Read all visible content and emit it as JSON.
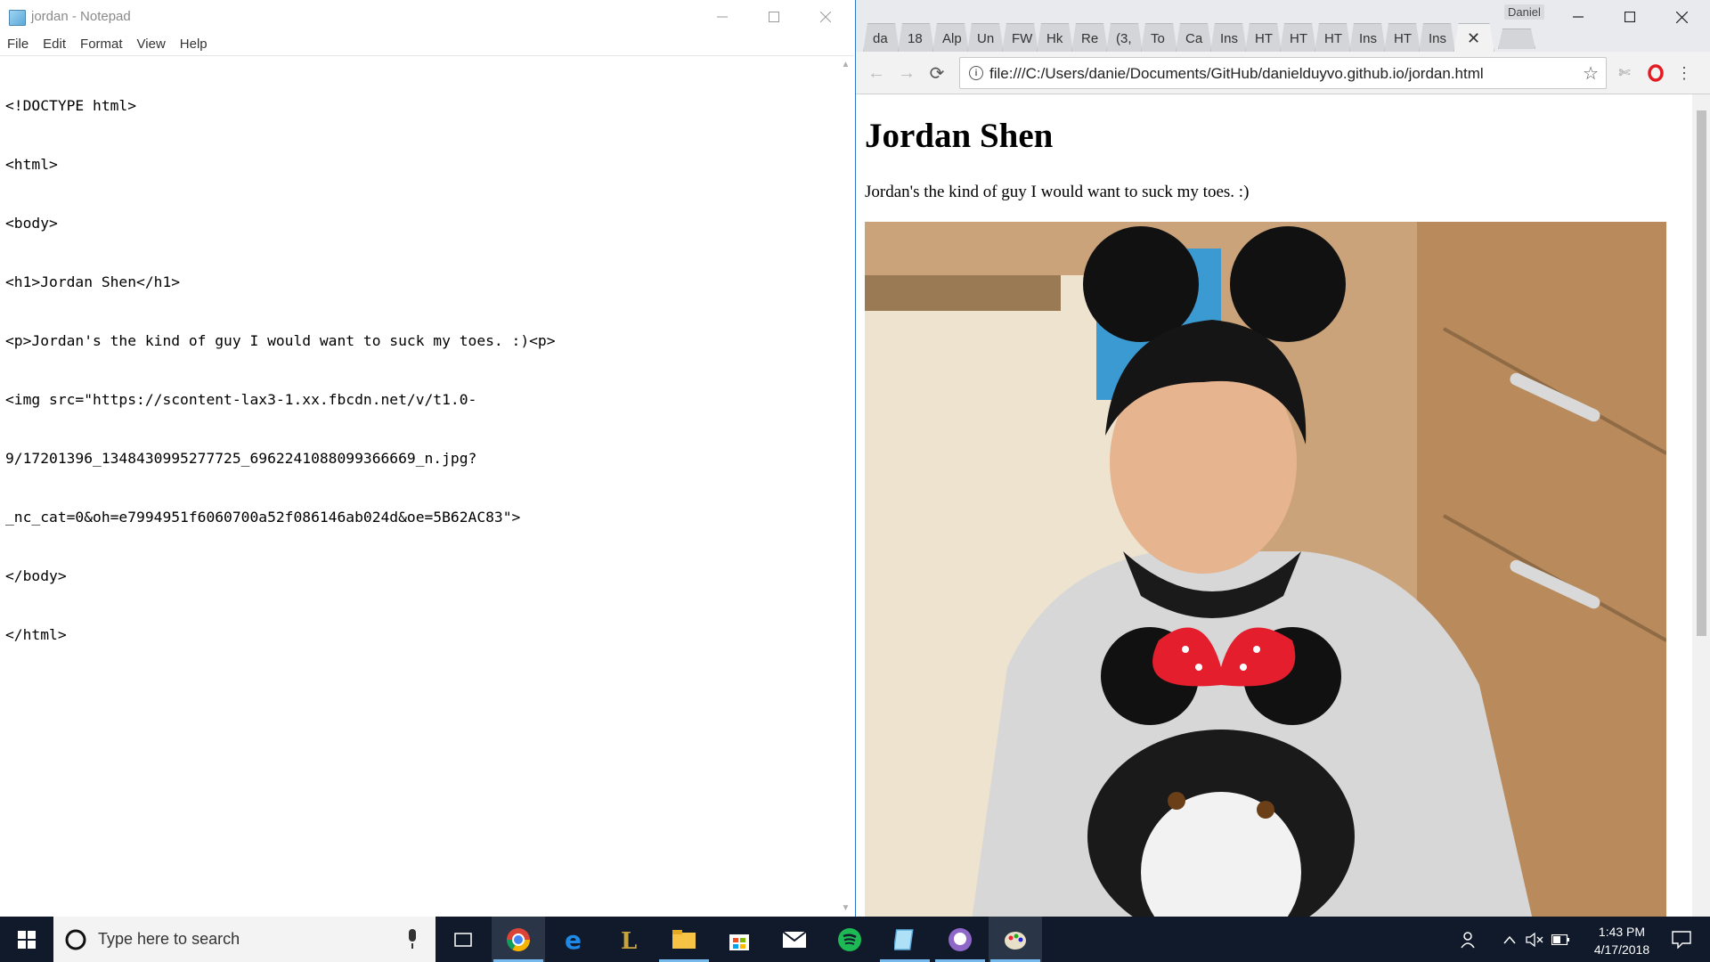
{
  "notepad": {
    "title": "jordan - Notepad",
    "menu": [
      "File",
      "Edit",
      "Format",
      "View",
      "Help"
    ],
    "code_lines": [
      "<!DOCTYPE html>",
      "<html>",
      "<body>",
      "<h1>Jordan Shen</h1>",
      "<p>Jordan's the kind of guy I would want to suck my toes. :)<p>",
      "<img src=\"https://scontent-lax3-1.xx.fbcdn.net/v/t1.0-",
      "9/17201396_1348430995277725_6962241088099366669_n.jpg?",
      "_nc_cat=0&oh=e7994951f6060700a52f086146ab024d&oe=5B62AC83\">",
      "</body>",
      "</html>"
    ]
  },
  "chrome": {
    "profile_name": "Daniel",
    "tabs": [
      "da",
      "18",
      "Alp",
      "Un",
      "FW",
      "Hk",
      "Re",
      "(3,",
      "To",
      "Ca",
      "Ins",
      "HT",
      "HT",
      "HT",
      "Ins",
      "HT",
      "Ins"
    ],
    "url": "file:///C:/Users/danie/Documents/GitHub/danielduyvo.github.io/jordan.html",
    "page": {
      "heading": "Jordan Shen",
      "paragraph": "Jordan's the kind of guy I would want to suck my toes. :)"
    }
  },
  "taskbar": {
    "search_placeholder": "Type here to search",
    "time": "1:43 PM",
    "date": "4/17/2018",
    "apps": [
      "chrome",
      "edge",
      "league-of-legends",
      "file-explorer",
      "store",
      "mail",
      "spotify",
      "notepad",
      "github-desktop",
      "paint"
    ]
  }
}
